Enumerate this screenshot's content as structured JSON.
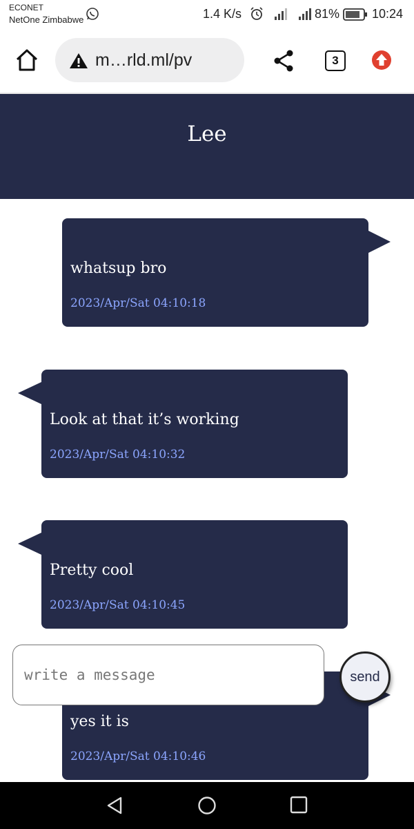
{
  "status_bar": {
    "carrier_primary": "ECONET",
    "carrier_secondary": "NetOne Zimbabwe",
    "net_speed": "1.4 K/s",
    "battery": "81%",
    "time": "10:24",
    "icons": [
      "whatsapp-icon",
      "alarm-icon",
      "signal-icon",
      "battery-icon"
    ]
  },
  "browser": {
    "url": "m…rld.ml/pv",
    "tab_count": "3",
    "icons": [
      "home-icon",
      "warning-icon",
      "share-icon",
      "update-icon"
    ]
  },
  "chat": {
    "title": "Lee",
    "messages": [
      {
        "side": "right",
        "text": "whatsup bro",
        "time": "2023/Apr/Sat 04:10:18"
      },
      {
        "side": "left",
        "text": "Look at that it’s working",
        "time": "2023/Apr/Sat 04:10:32"
      },
      {
        "side": "left",
        "text": "Pretty cool",
        "time": "2023/Apr/Sat 04:10:45"
      },
      {
        "side": "right",
        "text": "yes it is",
        "time": "2023/Apr/Sat 04:10:46"
      }
    ]
  },
  "compose": {
    "placeholder": "write a message",
    "value": "",
    "send_label": "send"
  },
  "colors": {
    "header_bg": "#252b49",
    "bubble_bg": "#252b49",
    "timestamp": "#8ca6ff"
  }
}
